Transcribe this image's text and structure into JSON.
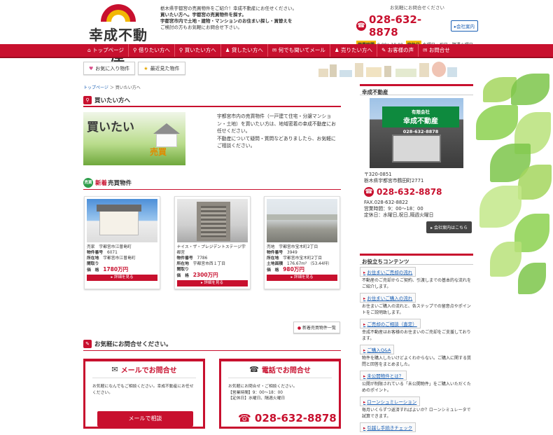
{
  "header": {
    "logo_text": "幸成不動産",
    "intro_lines": [
      "栃木県宇都宮の売買物件をご紹介！幸成不動産にお任せください。",
      "買いたい方へ。宇都宮の売買物件を探す。",
      "宇都宮市内で土地・建物・マンションのお住まい探し・買替えを",
      "ご検討の方もお気軽にお問合せ下さい。"
    ],
    "inquiry_label": "お気軽にお問合せください",
    "tel": "028-632-8878",
    "company_button": "会社案内",
    "hours_label": "営業時間",
    "hours": "9:00～18:00",
    "holiday_label": "定休日",
    "holiday": "水曜日・祝日・隔週火曜日"
  },
  "nav": {
    "items": [
      {
        "icon": "home-icon",
        "label": "トップページ"
      },
      {
        "icon": "search-icon",
        "label": "借りたい方へ"
      },
      {
        "icon": "search-icon",
        "label": "買いたい方へ"
      },
      {
        "icon": "user-icon",
        "label": "貸したい方へ"
      },
      {
        "icon": "mail-icon",
        "label": "何でも聞いてメール"
      },
      {
        "icon": "user-icon",
        "label": "売りたい方へ"
      },
      {
        "icon": "comment-icon",
        "label": "お客様の声"
      },
      {
        "icon": "mail-icon",
        "label": "お問合せ"
      }
    ],
    "accent": "#c8102e"
  },
  "subnav": {
    "favorites": "お気に入り物件",
    "recent": "最近見た物件"
  },
  "breadcrumb": {
    "home": "トップページ",
    "current": "買いたい方へ"
  },
  "section": {
    "title": "買いたい方へ",
    "banner_main": "買いたい",
    "banner_sub": "売買",
    "intro": [
      "宇都宮市内の売買物件（一戸建て住宅・分譲マンション・土地）を買いたい方は、地域密着の幸成不動産にお任せください。",
      "不動産について疑問・質問などありましたら、お気軽にご相談ください。"
    ]
  },
  "new_listings": {
    "badge": "売買",
    "title_new": "新着",
    "title_rest": "売買物件",
    "items": [
      {
        "type_area": "売家　宇都宮市江曽島町",
        "number_label": "物件番号",
        "number": "6071",
        "location_label": "所在地",
        "location": "宇都宮市江曽島町",
        "layout": "間取り",
        "price_label": "価　格",
        "price": "1780万円",
        "detail": "詳細を見る"
      },
      {
        "type_area": "ナイス・ザ・プレジデントステージ宇都宮",
        "number_label": "物件番号",
        "number": "7786",
        "location_label": "所在地",
        "location": "宇都宮市西１丁目",
        "layout": "間取り",
        "price_label": "価　格",
        "price": "2300万円",
        "detail": "詳細を見る"
      },
      {
        "type_area": "売地　宇都宮市宝木町2丁目",
        "number_label": "物件番号",
        "number": "3949",
        "location_label": "所在地",
        "location": "宇都宮市宝木町2丁目",
        "area_label": "土地面積",
        "area": "176.67m² （53.44坪）",
        "price_label": "価　格",
        "price": "980万円",
        "detail": "詳細を見る"
      }
    ],
    "more": "新着売買物件一覧"
  },
  "contact": {
    "title": "お気軽にお問合せください。",
    "mail_title": "メールでお問合せ",
    "mail_desc": "お気軽になんでもご相談ください。幸成不動産にお任せください。",
    "mail_button": "メールで相談",
    "tel_title": "電話でお問合せ",
    "tel_desc": [
      "お気軽にお問合せ・ご相談ください。",
      "【営業時間】9：00～18：00",
      "【定休日】水曜日、隔週火曜日"
    ],
    "tel": "028-632-8878"
  },
  "sidebar": {
    "company_title": "幸成不動産",
    "shop_sign_small": "有限会社",
    "shop_sign": "幸成不動産",
    "shop_sign_tel": "028-632-8878",
    "postal": "〒320-0851",
    "address": "栃木県宇都宮市鶴田町2771",
    "tel": "028-632-8878",
    "fax": "FAX.028-632-8822",
    "hours": "営業時間：9：00～18：00",
    "holiday": "定休日：水曜日,祝日,隔週火曜日",
    "company_button": "会社案内はこちら",
    "useful_title": "お役立ちコンテンツ",
    "useful": [
      {
        "label": "お住まいご売却の流れ",
        "desc": "不動産のご売却からご契約、引渡しまでの基本的な流れをご紹介します。"
      },
      {
        "label": "お住まいご購入の流れ",
        "desc": "お住まいご購入の流れと、各ステップでの留意点やポイントをご説明致します。"
      },
      {
        "label": "ご売却のご相談（査定）",
        "desc": "幸成不動産はお客様のお住まいのご売却をご支援しております。"
      },
      {
        "label": "ご購入Q&A",
        "desc": "物件を購入したいけどよくわからない。ご購入に関する質問と回答をまとめました。"
      },
      {
        "label": "未公開物件とは？",
        "desc": "公開が制限されている「未公開物件」をご購入いただくためのポイント。"
      },
      {
        "label": "ローンシュミレーション",
        "desc": "毎月いくらずつ返済すればよいか？ローンシミュレータで試算できます。"
      },
      {
        "label": "引越し手続きチェック",
        "desc": ""
      }
    ]
  }
}
